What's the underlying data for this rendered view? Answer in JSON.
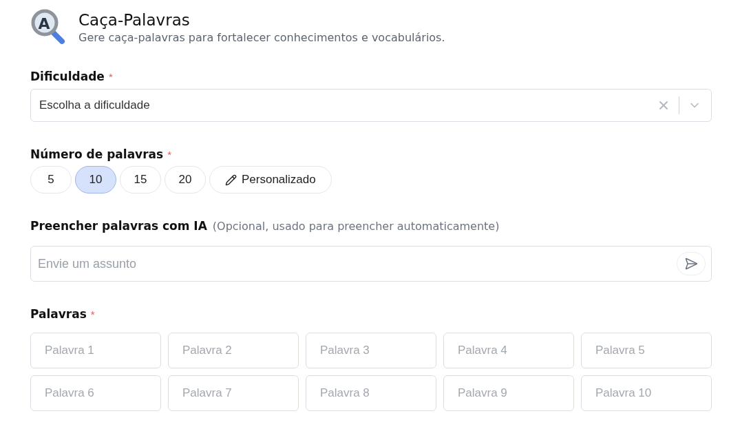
{
  "header": {
    "logo_letter": "A",
    "title": "Caça-Palavras",
    "subtitle": "Gere caça-palavras para fortalecer conhecimentos e vocabulários."
  },
  "difficulty": {
    "label": "Dificuldade",
    "required_mark": "*",
    "placeholder": "Escolha a dificuldade"
  },
  "word_count": {
    "label": "Número de palavras",
    "required_mark": "*",
    "options": [
      {
        "kind": "preset",
        "label": "5",
        "selected": false
      },
      {
        "kind": "preset",
        "label": "10",
        "selected": true
      },
      {
        "kind": "preset",
        "label": "15",
        "selected": false
      },
      {
        "kind": "preset",
        "label": "20",
        "selected": false
      },
      {
        "kind": "custom",
        "label": "Personalizado",
        "selected": false
      }
    ]
  },
  "ai_fill": {
    "label": "Preencher palavras com IA",
    "hint": "(Opcional, usado para preencher automaticamente)",
    "placeholder": "Envie um assunto"
  },
  "words": {
    "label": "Palavras",
    "required_mark": "*",
    "fields": [
      {
        "placeholder": "Palavra 1"
      },
      {
        "placeholder": "Palavra 2"
      },
      {
        "placeholder": "Palavra 3"
      },
      {
        "placeholder": "Palavra 4"
      },
      {
        "placeholder": "Palavra 5"
      },
      {
        "placeholder": "Palavra 6"
      },
      {
        "placeholder": "Palavra 7"
      },
      {
        "placeholder": "Palavra 8"
      },
      {
        "placeholder": "Palavra 9"
      },
      {
        "placeholder": "Palavra 10"
      }
    ]
  }
}
